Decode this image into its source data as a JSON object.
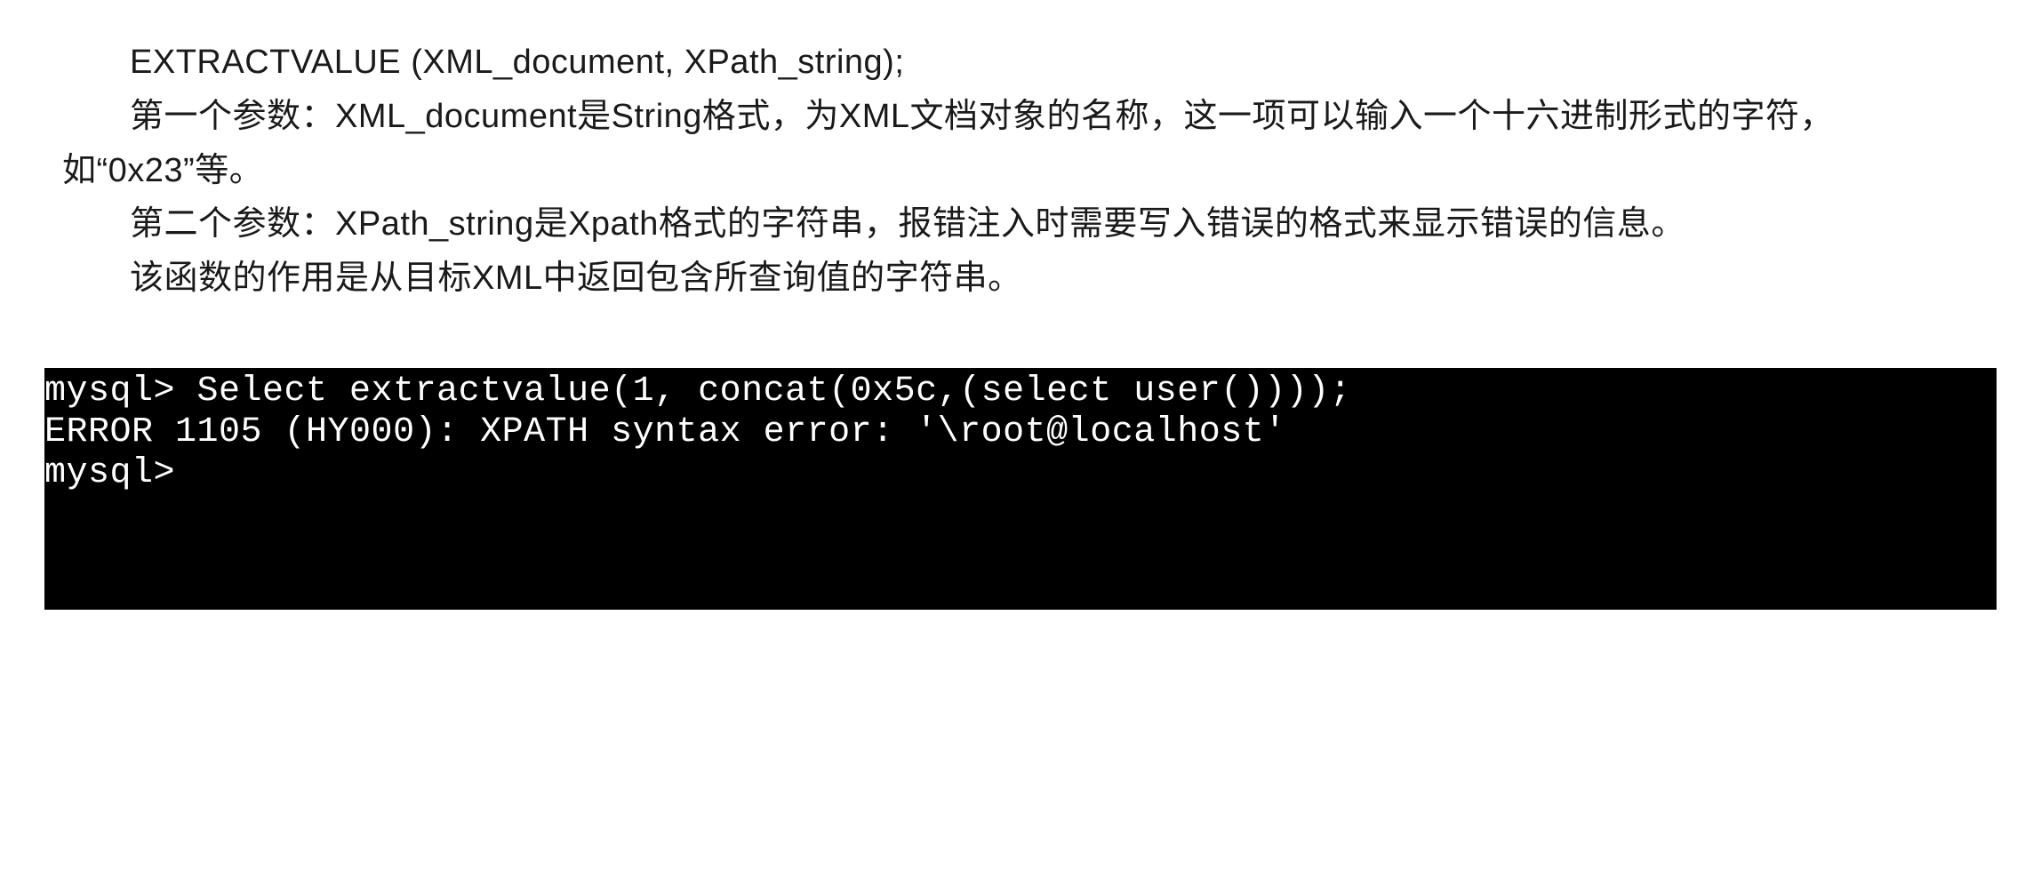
{
  "doc": {
    "line1": "EXTRACTVALUE (XML_document, XPath_string);",
    "line2": "第一个参数：XML_document是String格式，为XML文档对象的名称，这一项可以输入一个十六进制形式的字符，如“0x23”等。",
    "line3": "第二个参数：XPath_string是Xpath格式的字符串，报错注入时需要写入错误的格式来显示错误的信息。",
    "line4": "该函数的作用是从目标XML中返回包含所查询值的字符串。"
  },
  "terminal": {
    "line1": "mysql> Select extractvalue(1, concat(0x5c,(select user())));",
    "line2": "ERROR 1105 (HY000): XPATH syntax error: '\\root@localhost'",
    "line3": "mysql>"
  }
}
